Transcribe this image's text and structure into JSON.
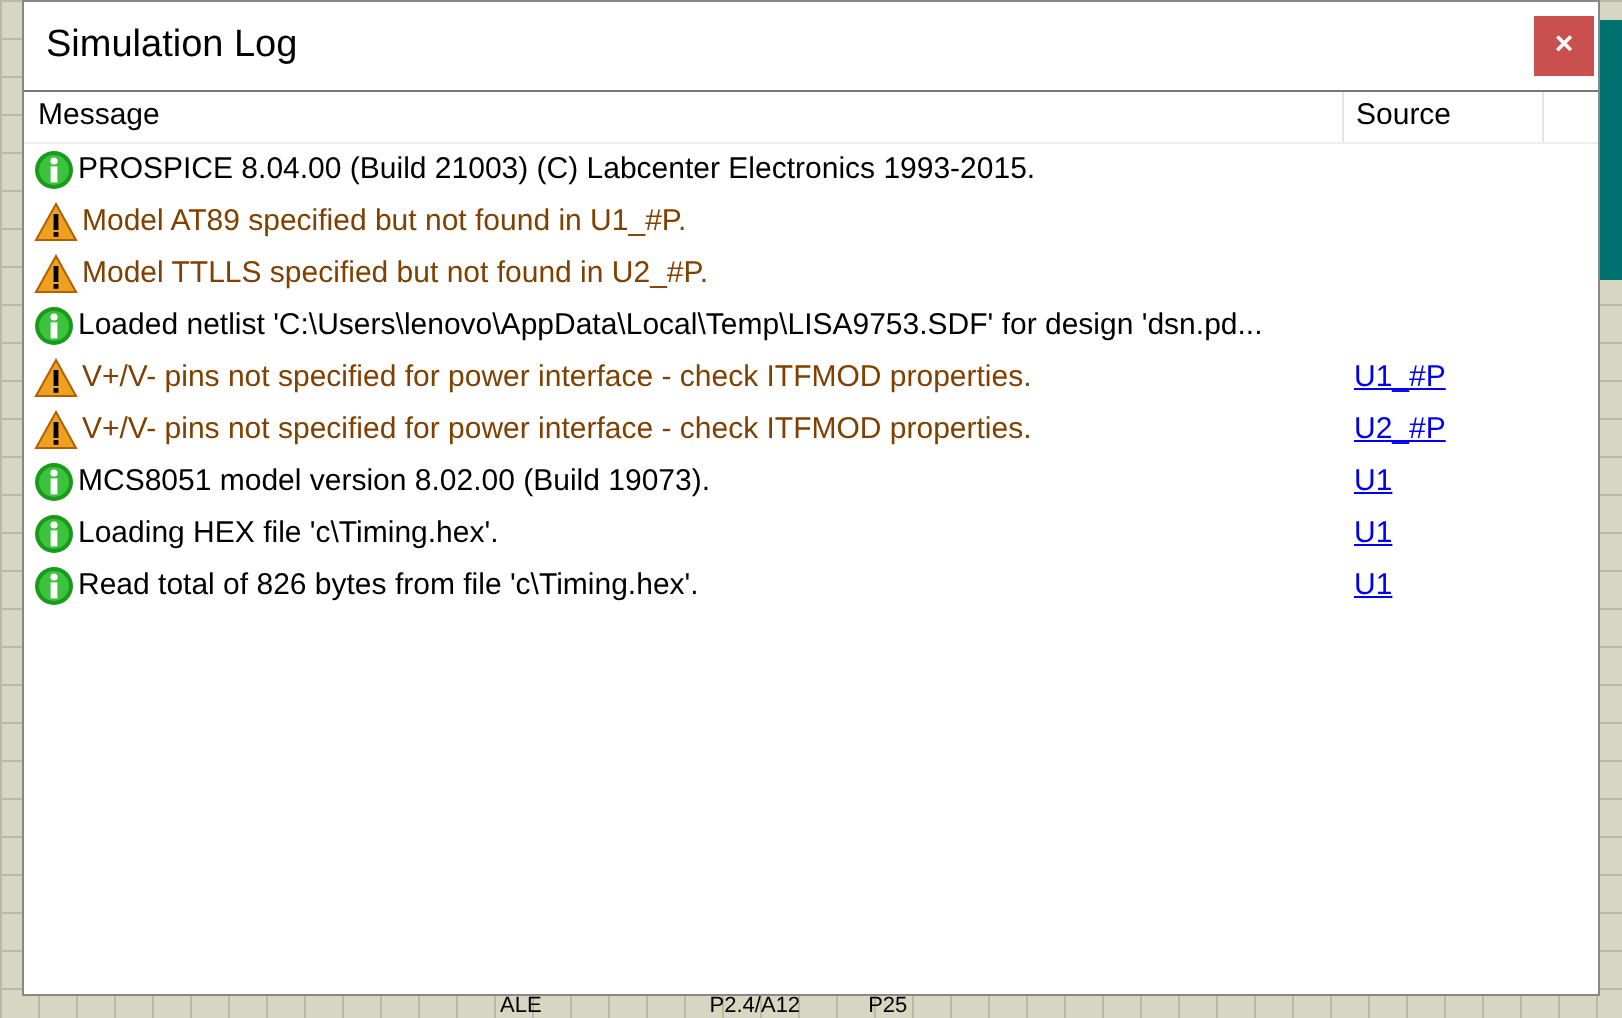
{
  "window": {
    "title": "Simulation Log",
    "close": "×"
  },
  "table": {
    "columns": [
      "Message",
      "Source"
    ],
    "rows": [
      {
        "kind": "info",
        "message": "PROSPICE 8.04.00 (Build 21003) (C) Labcenter Electronics 1993-2015."
      },
      {
        "kind": "warning",
        "message": "Model AT89 specified but not found in U1_#P."
      },
      {
        "kind": "warning",
        "message": "Model TTLLS specified but not found in U2_#P."
      },
      {
        "kind": "info",
        "message": "Loaded netlist 'C:\\Users\\lenovo\\AppData\\Local\\Temp\\LISA9753.SDF' for design 'dsn.pd..."
      },
      {
        "kind": "warning",
        "message": "V+/V- pins not specified for power interface - check ITFMOD properties.",
        "source": "U1_#P"
      },
      {
        "kind": "warning",
        "message": "V+/V- pins not specified for power interface - check ITFMOD properties.",
        "source": "U2_#P"
      },
      {
        "kind": "info",
        "message": "MCS8051 model version 8.02.00 (Build 19073).",
        "source": "U1"
      },
      {
        "kind": "info",
        "message": "Loading HEX file 'c\\Timing.hex'.",
        "source": "U1"
      },
      {
        "kind": "info",
        "message": "Read total of 826 bytes from file 'c\\Timing.hex'.",
        "source": "U1"
      }
    ]
  },
  "schematic_labels": [
    "ALE",
    "P2.4/A12",
    "P25"
  ]
}
